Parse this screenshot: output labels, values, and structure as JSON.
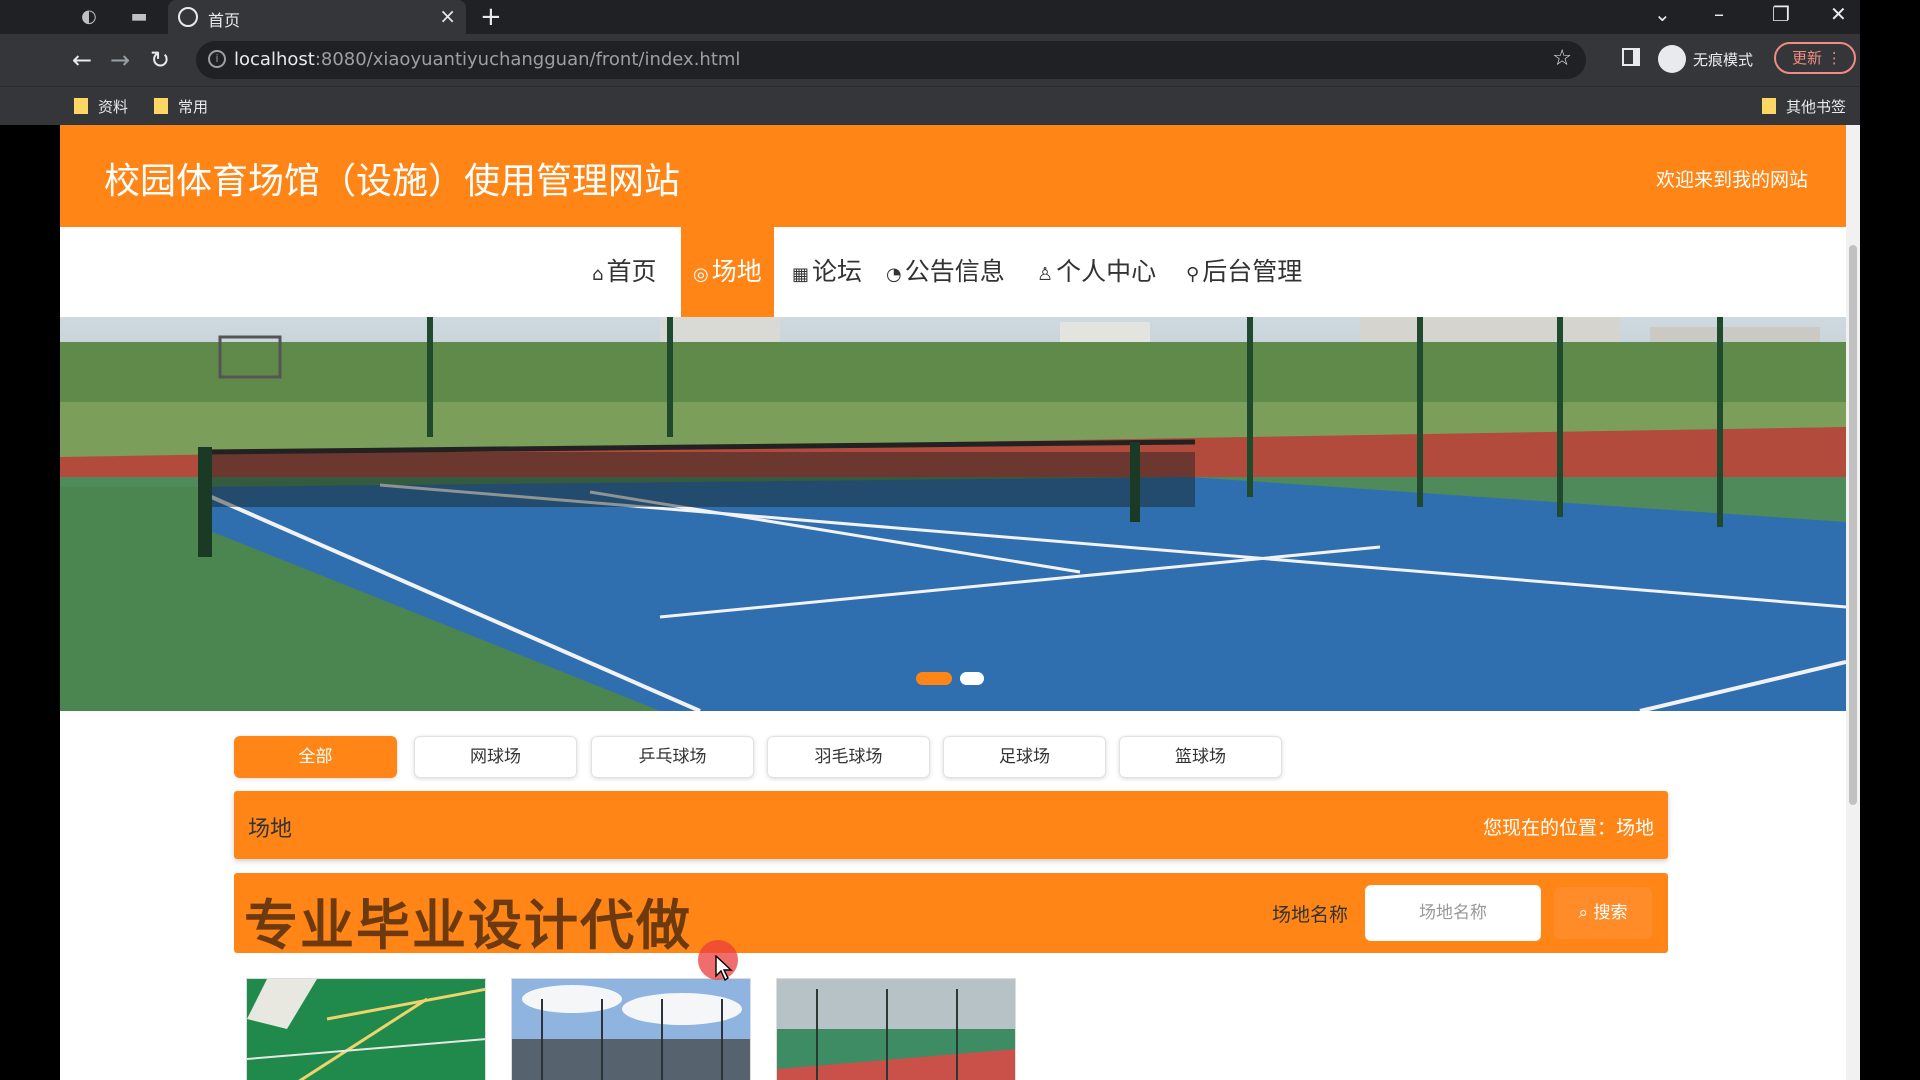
{
  "browser": {
    "tab_title": "首页",
    "url_host": "localhost",
    "url_rest": ":8080/xiaoyuantiyuchangguan/front/index.html",
    "incognito_label": "无痕模式",
    "update_label": "更新",
    "bookmarks": [
      "资料",
      "常用"
    ],
    "other_bookmarks": "其他书签"
  },
  "site": {
    "title": "校园体育场馆（设施）使用管理网站",
    "welcome": "欢迎来到我的网站"
  },
  "nav": [
    {
      "label": "首页",
      "icon": "home-icon"
    },
    {
      "label": "场地",
      "icon": "basketball-icon"
    },
    {
      "label": "论坛",
      "icon": "forum-icon"
    },
    {
      "label": "公告信息",
      "icon": "dashboard-icon"
    },
    {
      "label": "个人中心",
      "icon": "user-icon"
    },
    {
      "label": "后台管理",
      "icon": "link-icon"
    }
  ],
  "carousel": {
    "slide_count": 2,
    "active_index": 0
  },
  "categories": [
    "全部",
    "网球场",
    "乒乓球场",
    "羽毛球场",
    "足球场",
    "篮球场"
  ],
  "location": {
    "title": "场地",
    "path": "您现在的位置：场地"
  },
  "search": {
    "promo": "专业毕业设计代做",
    "label": "场地名称",
    "placeholder": "场地名称",
    "button": "搜索"
  },
  "colors": {
    "accent": "#ff8616",
    "browser_bg": "#202124",
    "toolbar_bg": "#35363a"
  }
}
